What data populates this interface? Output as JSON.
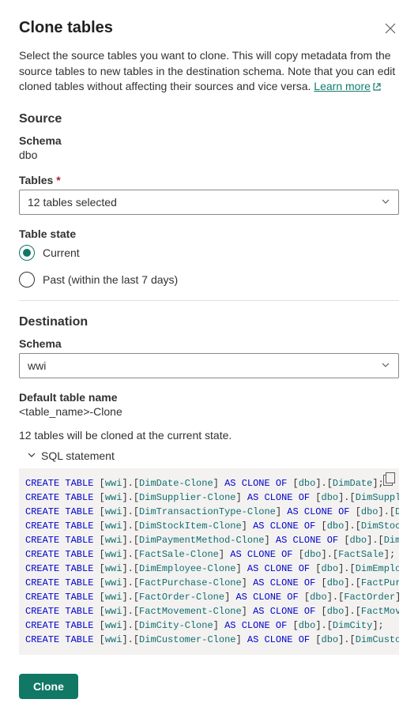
{
  "header": {
    "title": "Clone tables"
  },
  "intro": {
    "text": "Select the source tables you want to clone. This will copy metadata from the source tables to new tables in the destination schema. Note that you can edit cloned tables without affecting their sources and vice versa. ",
    "link_label": "Learn more"
  },
  "source": {
    "heading": "Source",
    "schema_label": "Schema",
    "schema_value": "dbo",
    "tables_label": "Tables",
    "tables_selected": "12 tables selected",
    "table_state_label": "Table state",
    "radios": {
      "current": {
        "label": "Current",
        "selected": true
      },
      "past": {
        "label": "Past (within the last 7 days)",
        "selected": false
      }
    }
  },
  "destination": {
    "heading": "Destination",
    "schema_label": "Schema",
    "schema_value": "wwi",
    "default_name_label": "Default table name",
    "default_name_value": "<table_name>-Clone"
  },
  "summary": {
    "count_text": "12 tables will be cloned at the current state.",
    "sql_label": "SQL statement"
  },
  "sql": {
    "kw_create_table": "CREATE TABLE",
    "kw_as": "AS",
    "kw_clone_of": "CLONE OF",
    "lines": [
      {
        "dst_schema": "wwi",
        "dst_table": "DimDate-Clone",
        "src_schema": "dbo",
        "src_table": "DimDate",
        "term": ";"
      },
      {
        "dst_schema": "wwi",
        "dst_table": "DimSupplier-Clone",
        "src_schema": "dbo",
        "src_table": "DimSupplier",
        "term": ";"
      },
      {
        "dst_schema": "wwi",
        "dst_table": "DimTransactionType-Clone",
        "src_schema": "dbo",
        "src_table": "DimTra",
        "term": ""
      },
      {
        "dst_schema": "wwi",
        "dst_table": "DimStockItem-Clone",
        "src_schema": "dbo",
        "src_table": "DimStockItem",
        "term": ""
      },
      {
        "dst_schema": "wwi",
        "dst_table": "DimPaymentMethod-Clone",
        "src_schema": "dbo",
        "src_table": "DimPayme",
        "term": ""
      },
      {
        "dst_schema": "wwi",
        "dst_table": "FactSale-Clone",
        "src_schema": "dbo",
        "src_table": "FactSale",
        "term": ";"
      },
      {
        "dst_schema": "wwi",
        "dst_table": "DimEmployee-Clone",
        "src_schema": "dbo",
        "src_table": "DimEmployee",
        "term": ";"
      },
      {
        "dst_schema": "wwi",
        "dst_table": "FactPurchase-Clone",
        "src_schema": "dbo",
        "src_table": "FactPurchase",
        "term": ""
      },
      {
        "dst_schema": "wwi",
        "dst_table": "FactOrder-Clone",
        "src_schema": "dbo",
        "src_table": "FactOrder",
        "term": ";"
      },
      {
        "dst_schema": "wwi",
        "dst_table": "FactMovement-Clone",
        "src_schema": "dbo",
        "src_table": "FactMovement",
        "term": ""
      },
      {
        "dst_schema": "wwi",
        "dst_table": "DimCity-Clone",
        "src_schema": "dbo",
        "src_table": "DimCity",
        "term": ";"
      },
      {
        "dst_schema": "wwi",
        "dst_table": "DimCustomer-Clone",
        "src_schema": "dbo",
        "src_table": "DimCustomer",
        "term": ";"
      }
    ]
  },
  "footer": {
    "clone_label": "Clone"
  }
}
